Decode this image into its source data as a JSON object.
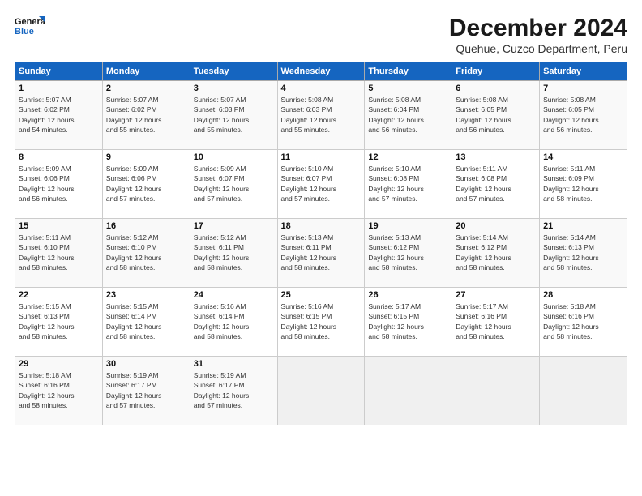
{
  "header": {
    "logo_line1": "General",
    "logo_line2": "Blue",
    "title": "December 2024",
    "subtitle": "Quehue, Cuzco Department, Peru"
  },
  "calendar": {
    "days_of_week": [
      "Sunday",
      "Monday",
      "Tuesday",
      "Wednesday",
      "Thursday",
      "Friday",
      "Saturday"
    ],
    "weeks": [
      [
        {
          "day": "",
          "info": ""
        },
        {
          "day": "2",
          "info": "Sunrise: 5:07 AM\nSunset: 6:02 PM\nDaylight: 12 hours\nand 55 minutes."
        },
        {
          "day": "3",
          "info": "Sunrise: 5:07 AM\nSunset: 6:03 PM\nDaylight: 12 hours\nand 55 minutes."
        },
        {
          "day": "4",
          "info": "Sunrise: 5:08 AM\nSunset: 6:03 PM\nDaylight: 12 hours\nand 55 minutes."
        },
        {
          "day": "5",
          "info": "Sunrise: 5:08 AM\nSunset: 6:04 PM\nDaylight: 12 hours\nand 56 minutes."
        },
        {
          "day": "6",
          "info": "Sunrise: 5:08 AM\nSunset: 6:05 PM\nDaylight: 12 hours\nand 56 minutes."
        },
        {
          "day": "7",
          "info": "Sunrise: 5:08 AM\nSunset: 6:05 PM\nDaylight: 12 hours\nand 56 minutes."
        }
      ],
      [
        {
          "day": "8",
          "info": "Sunrise: 5:09 AM\nSunset: 6:06 PM\nDaylight: 12 hours\nand 56 minutes."
        },
        {
          "day": "9",
          "info": "Sunrise: 5:09 AM\nSunset: 6:06 PM\nDaylight: 12 hours\nand 57 minutes."
        },
        {
          "day": "10",
          "info": "Sunrise: 5:09 AM\nSunset: 6:07 PM\nDaylight: 12 hours\nand 57 minutes."
        },
        {
          "day": "11",
          "info": "Sunrise: 5:10 AM\nSunset: 6:07 PM\nDaylight: 12 hours\nand 57 minutes."
        },
        {
          "day": "12",
          "info": "Sunrise: 5:10 AM\nSunset: 6:08 PM\nDaylight: 12 hours\nand 57 minutes."
        },
        {
          "day": "13",
          "info": "Sunrise: 5:11 AM\nSunset: 6:08 PM\nDaylight: 12 hours\nand 57 minutes."
        },
        {
          "day": "14",
          "info": "Sunrise: 5:11 AM\nSunset: 6:09 PM\nDaylight: 12 hours\nand 58 minutes."
        }
      ],
      [
        {
          "day": "15",
          "info": "Sunrise: 5:11 AM\nSunset: 6:10 PM\nDaylight: 12 hours\nand 58 minutes."
        },
        {
          "day": "16",
          "info": "Sunrise: 5:12 AM\nSunset: 6:10 PM\nDaylight: 12 hours\nand 58 minutes."
        },
        {
          "day": "17",
          "info": "Sunrise: 5:12 AM\nSunset: 6:11 PM\nDaylight: 12 hours\nand 58 minutes."
        },
        {
          "day": "18",
          "info": "Sunrise: 5:13 AM\nSunset: 6:11 PM\nDaylight: 12 hours\nand 58 minutes."
        },
        {
          "day": "19",
          "info": "Sunrise: 5:13 AM\nSunset: 6:12 PM\nDaylight: 12 hours\nand 58 minutes."
        },
        {
          "day": "20",
          "info": "Sunrise: 5:14 AM\nSunset: 6:12 PM\nDaylight: 12 hours\nand 58 minutes."
        },
        {
          "day": "21",
          "info": "Sunrise: 5:14 AM\nSunset: 6:13 PM\nDaylight: 12 hours\nand 58 minutes."
        }
      ],
      [
        {
          "day": "22",
          "info": "Sunrise: 5:15 AM\nSunset: 6:13 PM\nDaylight: 12 hours\nand 58 minutes."
        },
        {
          "day": "23",
          "info": "Sunrise: 5:15 AM\nSunset: 6:14 PM\nDaylight: 12 hours\nand 58 minutes."
        },
        {
          "day": "24",
          "info": "Sunrise: 5:16 AM\nSunset: 6:14 PM\nDaylight: 12 hours\nand 58 minutes."
        },
        {
          "day": "25",
          "info": "Sunrise: 5:16 AM\nSunset: 6:15 PM\nDaylight: 12 hours\nand 58 minutes."
        },
        {
          "day": "26",
          "info": "Sunrise: 5:17 AM\nSunset: 6:15 PM\nDaylight: 12 hours\nand 58 minutes."
        },
        {
          "day": "27",
          "info": "Sunrise: 5:17 AM\nSunset: 6:16 PM\nDaylight: 12 hours\nand 58 minutes."
        },
        {
          "day": "28",
          "info": "Sunrise: 5:18 AM\nSunset: 6:16 PM\nDaylight: 12 hours\nand 58 minutes."
        }
      ],
      [
        {
          "day": "29",
          "info": "Sunrise: 5:18 AM\nSunset: 6:16 PM\nDaylight: 12 hours\nand 58 minutes."
        },
        {
          "day": "30",
          "info": "Sunrise: 5:19 AM\nSunset: 6:17 PM\nDaylight: 12 hours\nand 57 minutes."
        },
        {
          "day": "31",
          "info": "Sunrise: 5:19 AM\nSunset: 6:17 PM\nDaylight: 12 hours\nand 57 minutes."
        },
        {
          "day": "",
          "info": ""
        },
        {
          "day": "",
          "info": ""
        },
        {
          "day": "",
          "info": ""
        },
        {
          "day": "",
          "info": ""
        }
      ]
    ],
    "week1_day1": {
      "day": "1",
      "info": "Sunrise: 5:07 AM\nSunset: 6:02 PM\nDaylight: 12 hours\nand 54 minutes."
    }
  }
}
